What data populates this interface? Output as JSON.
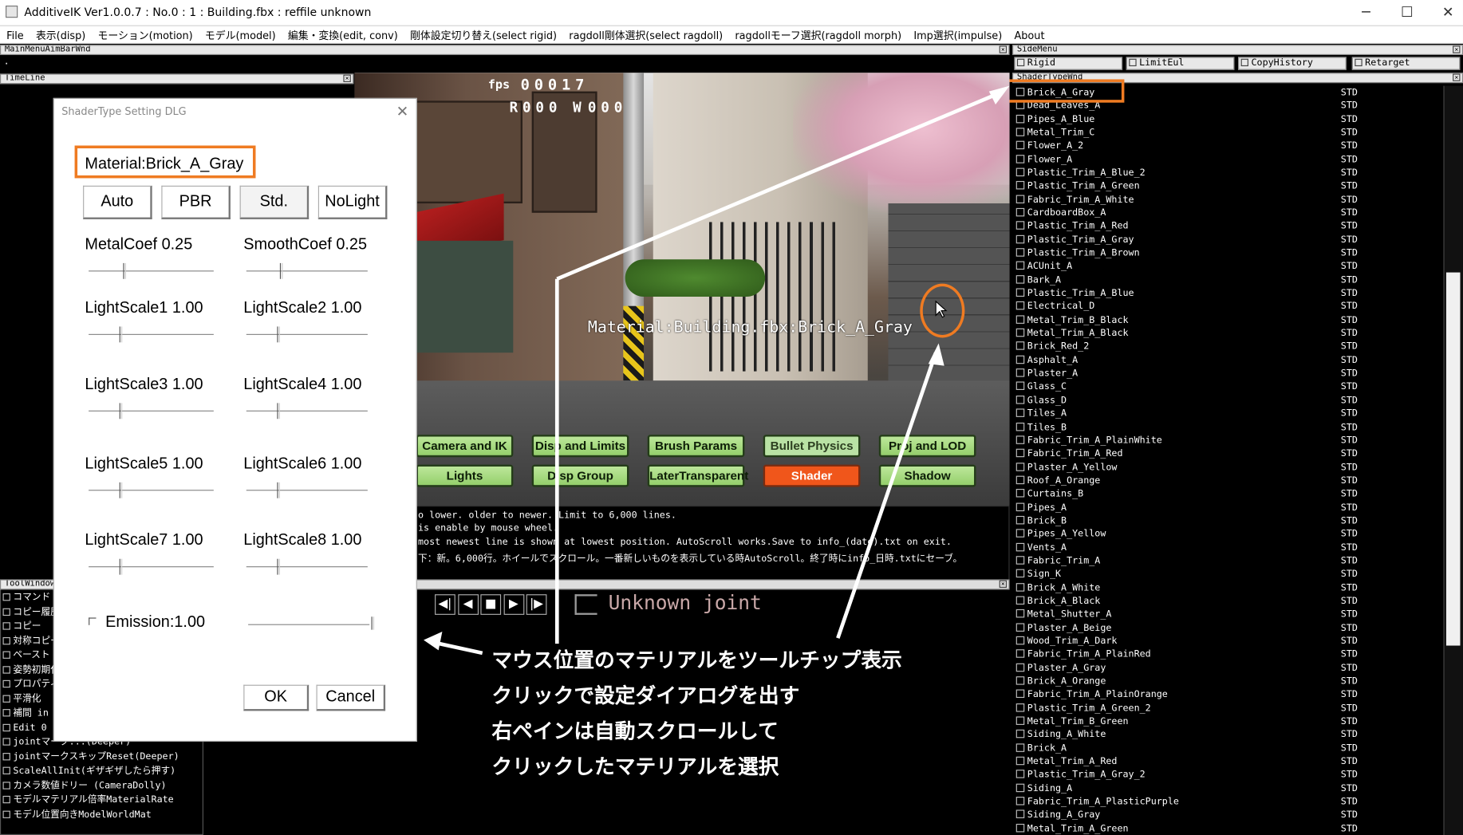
{
  "window": {
    "title": "AdditiveIK Ver1.0.0.7 : No.0 : 1 : Building.fbx : reffile unknown",
    "minimize": "─",
    "maximize": "☐",
    "close": "✕"
  },
  "menu": [
    "File",
    "表示(disp)",
    "モーション(motion)",
    "モデル(model)",
    "編集・変換(edit, conv)",
    "剛体設定切り替え(select rigid)",
    "ragdoll剛体選択(select ragdoll)",
    "ragdollモーフ選択(ragdoll morph)",
    "Imp選択(impulse)",
    "About"
  ],
  "panels": {
    "main_menu_aim": "MainMenuAimBarWnd",
    "main_menu_dot": ".",
    "timeline": "TimeLine",
    "side_menu": "SideMenu",
    "shader_type_window": "ShaderTypeWnd",
    "tool_window": "ToolWindow"
  },
  "side_tabs": [
    "Rigid",
    "LimitEul",
    "CopyHistory",
    "Retarget"
  ],
  "viewport": {
    "fps_label": "fps",
    "fps_value": "00017",
    "r_label": "R",
    "r_value": "000",
    "w_label": "W",
    "w_value": "000",
    "material_tooltip": "Material:Building.fbx:Brick_A_Gray"
  },
  "render_buttons": [
    {
      "label": "Camera and IK",
      "style": "g"
    },
    {
      "label": "Disp and Limits",
      "style": "g"
    },
    {
      "label": "Brush Params",
      "style": "g"
    },
    {
      "label": "Bullet Physics",
      "style": "p"
    },
    {
      "label": "Proj and LOD",
      "style": "g"
    },
    {
      "label": "Lights",
      "style": "g"
    },
    {
      "label": "Disp Group",
      "style": "g"
    },
    {
      "label": "LaterTransparent",
      "style": "g"
    },
    {
      "label": "Shader",
      "style": "o"
    },
    {
      "label": "Shadow",
      "style": "g"
    }
  ],
  "log_lines": [
    "o lower. older to newer. Limit to 6,000 lines.",
    "is enable by mouse wheel.",
    "most newest line is shown at lowest position. AutoScroll works.Save to info_(date).txt on exit.",
    "下：新。6,000行。ホイールでスクロール。一番新しいものを表示している時AutoScroll。終了時にinfo_日時.txtにセーブ。"
  ],
  "playback": {
    "joint_text": "Unknown joint",
    "controls": [
      "◀|",
      "◀",
      "■",
      "▶",
      "|▶"
    ]
  },
  "dialog": {
    "title": "ShaderType Setting DLG",
    "close": "✕",
    "material": "Material:Brick_A_Gray",
    "mode_buttons": [
      "Auto",
      "PBR",
      "Std.",
      "NoLight"
    ],
    "sliders": [
      {
        "label": "MetalCoef 0.25",
        "value": 0.25
      },
      {
        "label": "SmoothCoef 0.25",
        "value": 0.25
      },
      {
        "label": "LightScale1 1.00",
        "value": 1.0
      },
      {
        "label": "LightScale2 1.00",
        "value": 1.0
      },
      {
        "label": "LightScale3 1.00",
        "value": 1.0
      },
      {
        "label": "LightScale4 1.00",
        "value": 1.0
      },
      {
        "label": "LightScale5 1.00",
        "value": 1.0
      },
      {
        "label": "LightScale6 1.00",
        "value": 1.0
      },
      {
        "label": "LightScale7 1.00",
        "value": 1.0
      },
      {
        "label": "LightScale8 1.00",
        "value": 1.0
      }
    ],
    "emission_label": "Emission:1.00",
    "ok": "OK",
    "cancel": "Cancel"
  },
  "tool_items": [
    "コマンド",
    "コピー履歴",
    "コピー",
    "対称コピー",
    "ペースト",
    "姿勢初期化",
    "プロパティ",
    "平滑化",
    "補間 in",
    "Edit 0",
    "jointマーク...(Deeper)",
    "jointマークスキップReset(Deeper)",
    "ScaleAllInit(ギザギザしたら押す)",
    "カメラ数値ドリー (CameraDolly)",
    "モデルマテリアル倍率MaterialRate",
    "モデル位置向きModelWorldMat"
  ],
  "materials": [
    "Brick_A_Gray",
    "Dead_Leaves_A",
    "Pipes_A_Blue",
    "Metal_Trim_C",
    "Flower_A_2",
    "Flower_A",
    "Plastic_Trim_A_Blue_2",
    "Plastic_Trim_A_Green",
    "Fabric_Trim_A_White",
    "CardboardBox_A",
    "Plastic_Trim_A_Red",
    "Plastic_Trim_A_Gray",
    "Plastic_Trim_A_Brown",
    "ACUnit_A",
    "Bark_A",
    "Plastic_Trim_A_Blue",
    "Electrical_D",
    "Metal_Trim_B_Black",
    "Metal_Trim_A_Black",
    "Brick_Red_2",
    "Asphalt_A",
    "Plaster_A",
    "Glass_C",
    "Glass_D",
    "Tiles_A",
    "Tiles_B",
    "Fabric_Trim_A_PlainWhite",
    "Fabric_Trim_A_Red",
    "Plaster_A_Yellow",
    "Roof_A_Orange",
    "Curtains_B",
    "Pipes_A",
    "Brick_B",
    "Pipes_A_Yellow",
    "Vents_A",
    "Fabric_Trim_A",
    "Sign_K",
    "Brick_A_White",
    "Brick_A_Black",
    "Metal_Shutter_A",
    "Plaster_A_Beige",
    "Wood_Trim_A_Dark",
    "Fabric_Trim_A_PlainRed",
    "Plaster_A_Gray",
    "Brick_A_Orange",
    "Fabric_Trim_A_PlainOrange",
    "Plastic_Trim_A_Green_2",
    "Metal_Trim_B_Green",
    "Siding_A_White",
    "Brick_A",
    "Metal_Trim_A_Red",
    "Plastic_Trim_A_Gray_2",
    "Siding_A",
    "Fabric_Trim_A_PlasticPurple",
    "Siding_A_Gray",
    "Metal_Trim_A_Green"
  ],
  "material_type": "STD",
  "annotation": [
    "マウス位置のマテリアルをツールチップ表示",
    "クリックで設定ダイアログを出す",
    "右ペインは自動スクロールして",
    "クリックしたマテリアルを選択"
  ],
  "colors": {
    "highlight": "#ef7b22",
    "shader_button": "#f0561b",
    "render_button": "#a9dc80"
  }
}
